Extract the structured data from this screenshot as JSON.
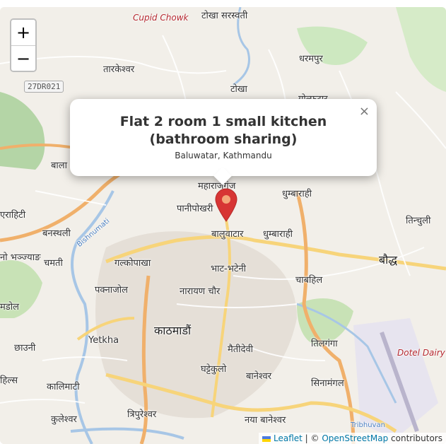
{
  "zoom": {
    "in_label": "+",
    "out_label": "−"
  },
  "popup": {
    "title": "Flat 2 room 1 small kitchen (bathroom sharing)",
    "subtitle": "Baluwatar, Kathmandu",
    "close_label": "×"
  },
  "marker": {
    "color": "#d73534",
    "icon": "map-pin-icon"
  },
  "attribution": {
    "leaflet": "Leaflet",
    "separator": " | © ",
    "osm": "OpenStreetMap",
    "suffix": " contributors"
  },
  "map_labels": {
    "cupid_chowk": "Cupid Chowk",
    "tokha_saraswati": "टोखा सरस्वती",
    "tarakeshwar": "तारकेश्वर",
    "shield": "27DR021",
    "tokha": "टोखा",
    "dharampur": "धरमपुर",
    "golphutar": "गोल्फुटार",
    "bala": "बाला",
    "maharajganj": "महाराजगंज",
    "dhumbarahi_n": "धुम्बाराही",
    "panipokhari": "पानीपोखरी",
    "erahiti": "एराहिटी",
    "banasthali": "बनस्थली",
    "tinchuli": "तिन्चुली",
    "baluwatar": "बालुवाटार",
    "dhumbarahi": "धुम्बाराही",
    "bhanjyang": "नो भञ्ज्याङ",
    "chamati": "चमती",
    "galkopakha": "गल्कोपाखा",
    "bhat_bhateni": "भाट-भटेनी",
    "baudha": "बौद्ध",
    "chabahil": "चाबहिल",
    "pakhanajol": "पक्नाजोल",
    "narayan_chaur": "नारायण चौर",
    "mandala": "मडोल",
    "kathmandu": "काठमाडौं",
    "yetkha": "Yetkha",
    "tilganga": "तिलगंगा",
    "chhauni": "छाउनी",
    "maitidevi": "मैतीदेवी",
    "dotel": "Dotel Dairy C",
    "hilsa": "हिल्स",
    "ghattekulo": "घट्टेकुलो",
    "baneshwor": "बानेश्वर",
    "kalimati": "कालिमाटी",
    "sinamangal": "सिनामंगल",
    "kuleshwor": "कुलेश्वर",
    "tripureshwor": "त्रिपुरेश्वर",
    "naya_baneshwor": "नया बानेश्वर",
    "tribhuvan": "Tribhuvan",
    "bishnumati": "Bishnumati"
  }
}
